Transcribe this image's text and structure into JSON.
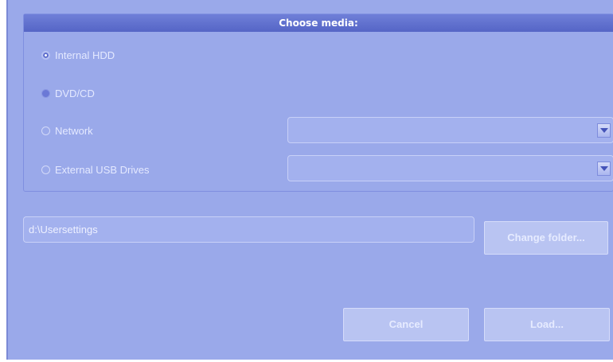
{
  "media_group": {
    "title": "Choose media:",
    "options": [
      {
        "label": "Internal HDD",
        "state": "selected"
      },
      {
        "label": "DVD/CD",
        "state": "disabled-filled"
      },
      {
        "label": "Network",
        "state": "unselected"
      },
      {
        "label": "External USB Drives",
        "state": "unselected"
      }
    ],
    "network_select_value": "",
    "usb_select_value": ""
  },
  "folder": {
    "path": "d:\\Usersettings",
    "change_button": "Change folder..."
  },
  "actions": {
    "cancel": "Cancel",
    "load": "Load..."
  },
  "colors": {
    "dialog_bg": "#9aa9ea",
    "title_bar": "#5f6fd0",
    "button_bg": "#b9c4f2"
  }
}
